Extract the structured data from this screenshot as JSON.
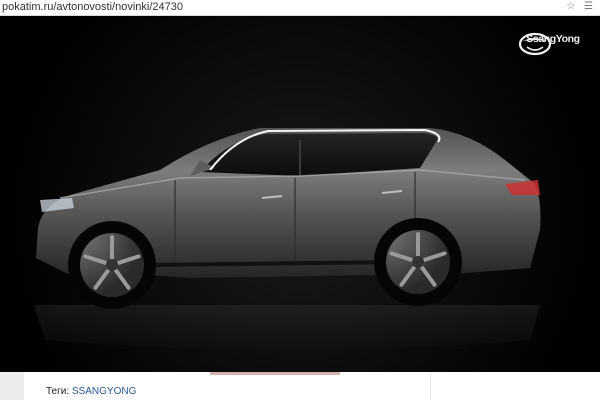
{
  "browser": {
    "url": "pokatim.ru/avtonovosti/novinki/24730",
    "toolbar_icons": "☆ ☰"
  },
  "hero": {
    "logo_text": "SsangYong",
    "logo_icon": "ssangyong-dragon-wings-icon"
  },
  "tags": {
    "label": "Теги:",
    "value": "SSANGYONG"
  }
}
